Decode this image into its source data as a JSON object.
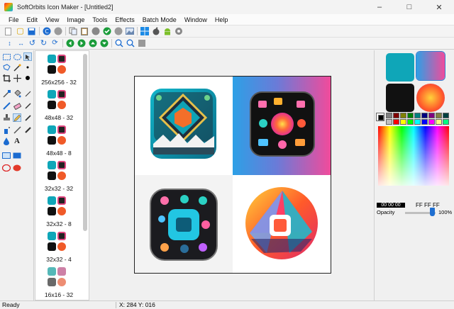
{
  "window": {
    "title": "SoftOrbits Icon Maker - [Untitled2]",
    "minimize": "–",
    "maximize": "□",
    "close": "✕"
  },
  "menu": [
    "File",
    "Edit",
    "View",
    "Image",
    "Tools",
    "Effects",
    "Batch Mode",
    "Window",
    "Help"
  ],
  "sizes": [
    {
      "label": "256x256 - 32"
    },
    {
      "label": "48x48 - 32"
    },
    {
      "label": "48x48 - 8"
    },
    {
      "label": "32x32 - 32"
    },
    {
      "label": "32x32 - 8"
    },
    {
      "label": "32x32 - 4"
    },
    {
      "label": "16x16 - 32"
    }
  ],
  "color_panel": {
    "current_color": "00 00 00",
    "alt_color": "FF FF FF",
    "opacity_label": "Opacity",
    "opacity_value": "100%",
    "opacity": 1.0
  },
  "status": {
    "text": "Ready",
    "coords": "X: 284 Y: 016"
  },
  "colors": {
    "accent": "#1f6fd1",
    "play_green": "#1a9c3a",
    "disc_blue": "#1b6bd0"
  }
}
